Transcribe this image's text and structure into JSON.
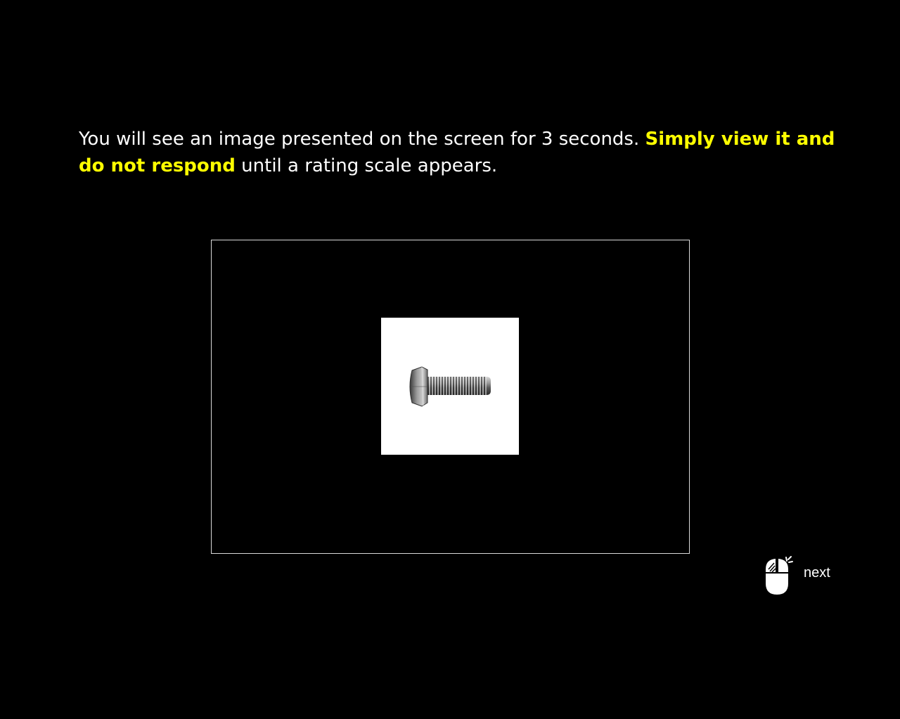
{
  "instructions": {
    "part1": "You will see an image presented on the screen for 3 seconds. ",
    "emphasis": "Simply view it and do not respond",
    "part2": " until a rating scale appears."
  },
  "stimulus": {
    "icon": "bolt-image"
  },
  "next": {
    "icon": "mouse-click-icon",
    "label": "next"
  },
  "colors": {
    "background": "#000000",
    "text": "#ffffff",
    "emphasis": "#ffff00",
    "frame_border": "#d9d9d9"
  }
}
